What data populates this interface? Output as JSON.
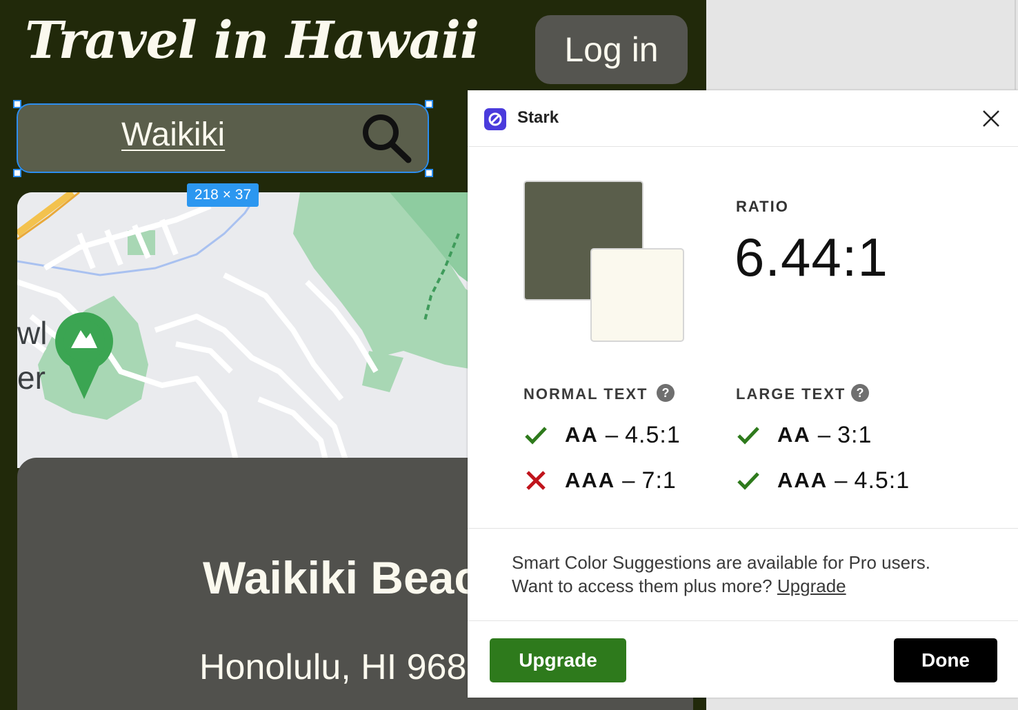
{
  "app": {
    "title": "Travel in Hawaii",
    "login_label": "Log in",
    "search_value": "Waikiki",
    "selection_size": "218 × 37",
    "place": {
      "name": "Waikiki Beach",
      "address": "Honolulu, HI 968"
    },
    "map": {
      "visible_labels": [
        "wl",
        "er"
      ]
    },
    "colors": {
      "app_background": "#21290a",
      "search_background": "#5a5e4b",
      "text_color": "#fbf9ee",
      "card_background": "#51514d",
      "selection_blue": "#2c8ef0"
    }
  },
  "stark": {
    "title": "Stark",
    "ratio_label": "RATIO",
    "ratio_value": "6.44:1",
    "foreground_color": "#5a5e4b",
    "background_color": "#fbf9ee",
    "normal_text": {
      "heading": "NORMAL TEXT",
      "checks": [
        {
          "level": "AA",
          "ratio": "4.5:1",
          "status": "pass"
        },
        {
          "level": "AAA",
          "ratio": "7:1",
          "status": "fail"
        }
      ]
    },
    "large_text": {
      "heading": "LARGE TEXT",
      "checks": [
        {
          "level": "AA",
          "ratio": "3:1",
          "status": "pass"
        },
        {
          "level": "AAA",
          "ratio": "4.5:1",
          "status": "pass"
        }
      ]
    },
    "dash": "–",
    "help_glyph": "?",
    "suggestion_line1": "Smart Color Suggestions are available for Pro users.",
    "suggestion_line2": "Want to access them plus more?",
    "suggestion_link": "Upgrade",
    "upgrade_button": "Upgrade",
    "done_button": "Done",
    "colors": {
      "logo": "#4a3bdc",
      "pass": "#2e7a1c",
      "fail": "#c0141c",
      "upgrade_button": "#2e7a1c",
      "done_button": "#000000"
    }
  }
}
